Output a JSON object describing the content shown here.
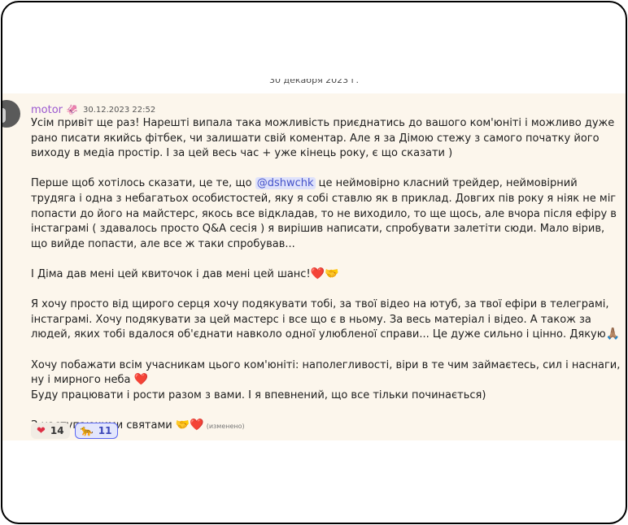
{
  "date_divider": "30 декабря 2023 г.",
  "message": {
    "author": "motor",
    "role_icon": "🦑",
    "timestamp": "30.12.2023 22:52",
    "p1": "Усім привіт ще раз! Нарешті випала така можливість приєднатись до вашого ком'юніті і можливо дуже рано писати якийсь фітбек, чи залишати свій коментар. Але я за Дімою стежу з самого початку його виходу в медіа простір. І за цей весь час + уже кінець року, є що сказати )",
    "p2_before": "Перше щоб хотілось сказати, це те, що ",
    "mention": "@dshwchk",
    "p2_after": " це неймовірно класний трейдер, неймовірний трудяга і одна з небагатьох особистостей, яку я собі ставлю як в приклад. Довгих пів року я ніяк не міг попасти до його на майстерс, якось все відкладав, то не виходило, то ще щось, але вчора після ефіру в інстаграмі ( здавалось просто Q&A сесія ) я вирішив написати, спробувати залетіти сюди. Мало вірив, що вийде попасти, але все ж таки спробував...",
    "p3": "І Діма дав мені цей квиточок і дав мені цей шанс!",
    "p3_emoji": "❤️🤝",
    "p4": "Я хочу просто від  щирого серця хочу подякувати тобі, за твої відео на ютуб, за твої ефіри в телеграмі, інстаграмі. Хочу подякувати за цей мастерс і все що є в ньому. За весь матеріал і відео. А також за людей, яких тобі вдалося об'єднати навколо одної улюбленої справи... Це дуже сильно і цінно. Дякую",
    "p4_emoji": "🙏🏽",
    "p5": "Хочу побажати всім учасникам цього ком'юніті: наполегливості, віри в те чим займаєтесь, сил і наснаги, ну і мирного неба",
    "p5_emoji": "❤️",
    "p6": "Буду працювати і рости разом з вами. І я впевнений, що все тільки починається)",
    "p7": "З наступаючими святами",
    "p7_emoji": "🤝❤️",
    "edited": "(изменено)"
  },
  "reactions": [
    {
      "emoji": "❤",
      "count": "14",
      "active": false
    },
    {
      "emoji": "🐆",
      "count": "11",
      "active": true
    }
  ]
}
